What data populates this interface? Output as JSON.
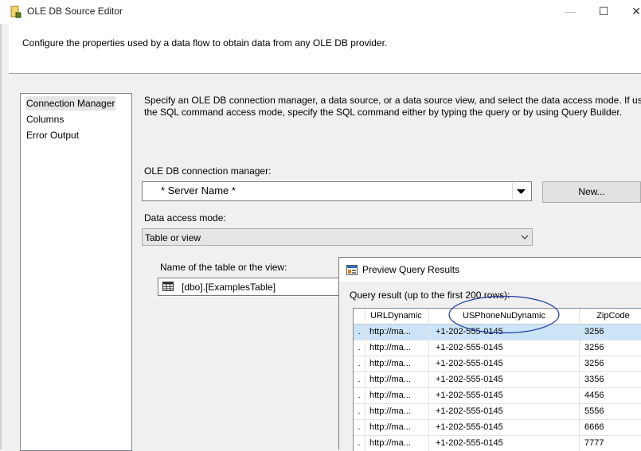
{
  "window": {
    "title": "OLE DB Source Editor",
    "controls": {
      "minimize": "—",
      "maximize": "☐",
      "close": "✕"
    }
  },
  "header": {
    "text": "Configure the properties used by a data flow to obtain data from any OLE DB provider."
  },
  "nav": {
    "items": [
      {
        "label": "Connection Manager",
        "selected": true
      },
      {
        "label": "Columns",
        "selected": false
      },
      {
        "label": "Error Output",
        "selected": false
      }
    ]
  },
  "description": {
    "line1": "Specify an OLE DB connection manager, a data source, or a data source view, and select the data access mode. If using",
    "line2": "the SQL command access mode, specify the SQL command either by typing the query or by using Query Builder."
  },
  "connection": {
    "label": "OLE DB connection manager:",
    "value": "* Server Name *",
    "new_button": "New..."
  },
  "access_mode": {
    "label": "Data access mode:",
    "value": "Table or view"
  },
  "table": {
    "label": "Name of the table or the view:",
    "value": "[dbo].[ExamplesTable]"
  },
  "preview": {
    "title": "Preview Query Results",
    "sublabel": "Query result (up to the first 200 rows):",
    "columns": [
      "URLDynamic",
      "USPhoneNuDynamic",
      "ZipCode"
    ],
    "rows": [
      {
        "url": "http://ma...",
        "phone": "+1-202-555-0145",
        "zip": "3256"
      },
      {
        "url": "http://ma...",
        "phone": "+1-202-555-0145",
        "zip": "3256"
      },
      {
        "url": "http://ma...",
        "phone": "+1-202-555-0145",
        "zip": "3256"
      },
      {
        "url": "http://ma...",
        "phone": "+1-202-555-0145",
        "zip": "3356"
      },
      {
        "url": "http://ma...",
        "phone": "+1-202-555-0145",
        "zip": "4456"
      },
      {
        "url": "http://ma...",
        "phone": "+1-202-555-0145",
        "zip": "5556"
      },
      {
        "url": "http://ma...",
        "phone": "+1-202-555-0145",
        "zip": "6666"
      },
      {
        "url": "http://ma...",
        "phone": "+1-202-555-0145",
        "zip": "7777"
      }
    ],
    "row_marker": "."
  },
  "colors": {
    "selected_row": "#cce4f7",
    "annotation_ellipse": "#1f3a9e"
  },
  "icons": {
    "window": "ssis-source-icon",
    "dropdown": "dropdown-arrow-icon",
    "chevron": "chevron-down-icon",
    "table": "table-grid-icon",
    "preview": "preview-results-icon"
  }
}
